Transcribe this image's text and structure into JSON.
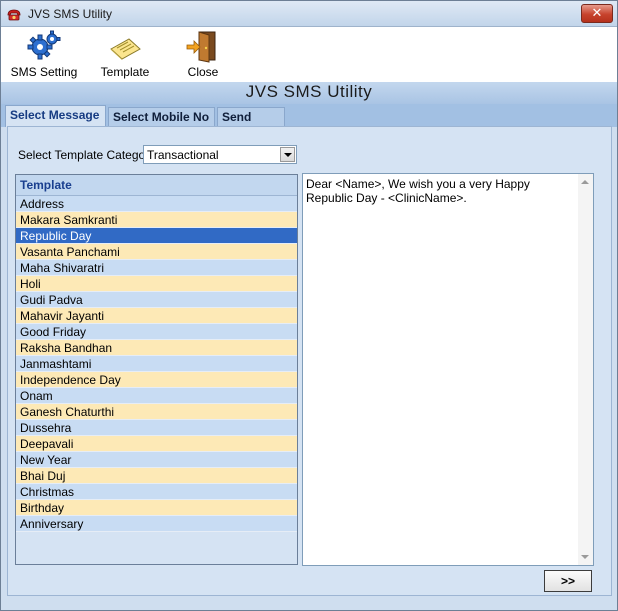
{
  "window": {
    "title": "JVS SMS Utility",
    "close_glyph": "✕"
  },
  "toolbar": {
    "sms_setting_label": "SMS Setting",
    "template_label": "Template",
    "close_label": "Close"
  },
  "banner": {
    "title": "JVS SMS Utility"
  },
  "tabs": [
    {
      "label": "Select Message",
      "active": true
    },
    {
      "label": "Select Mobile No",
      "active": false
    },
    {
      "label": "Send SMS",
      "active": false
    }
  ],
  "category": {
    "label": "Select Template Category",
    "selected": "Transactional"
  },
  "template_list": {
    "header": "Template",
    "items": [
      "Address",
      "Makara Samkranti",
      "Republic Day",
      "Vasanta Panchami",
      "Maha Shivaratri",
      "Holi",
      "Gudi Padva",
      "Mahavir Jayanti",
      "Good Friday",
      "Raksha Bandhan",
      "Janmashtami",
      "Independence Day",
      "Onam",
      "Ganesh Chaturthi",
      "Dussehra",
      "Deepavali",
      "New Year",
      "Bhai Duj",
      "Christmas",
      "Birthday",
      "Anniversary"
    ],
    "selected": "Republic Day"
  },
  "message": {
    "text": "Dear <Name>, We wish you a very Happy Republic Day - <ClinicName>."
  },
  "next_button": {
    "label": ">>"
  },
  "colors": {
    "window_bg": "#cfdeef",
    "selection": "#316ac5",
    "row_blue": "#c8dcf3",
    "row_yellow": "#fde9b6"
  },
  "icons": {
    "app": "red-phone-icon",
    "sms_setting": "gears-icon",
    "template": "paper-note-icon",
    "close": "exit-door-icon"
  }
}
